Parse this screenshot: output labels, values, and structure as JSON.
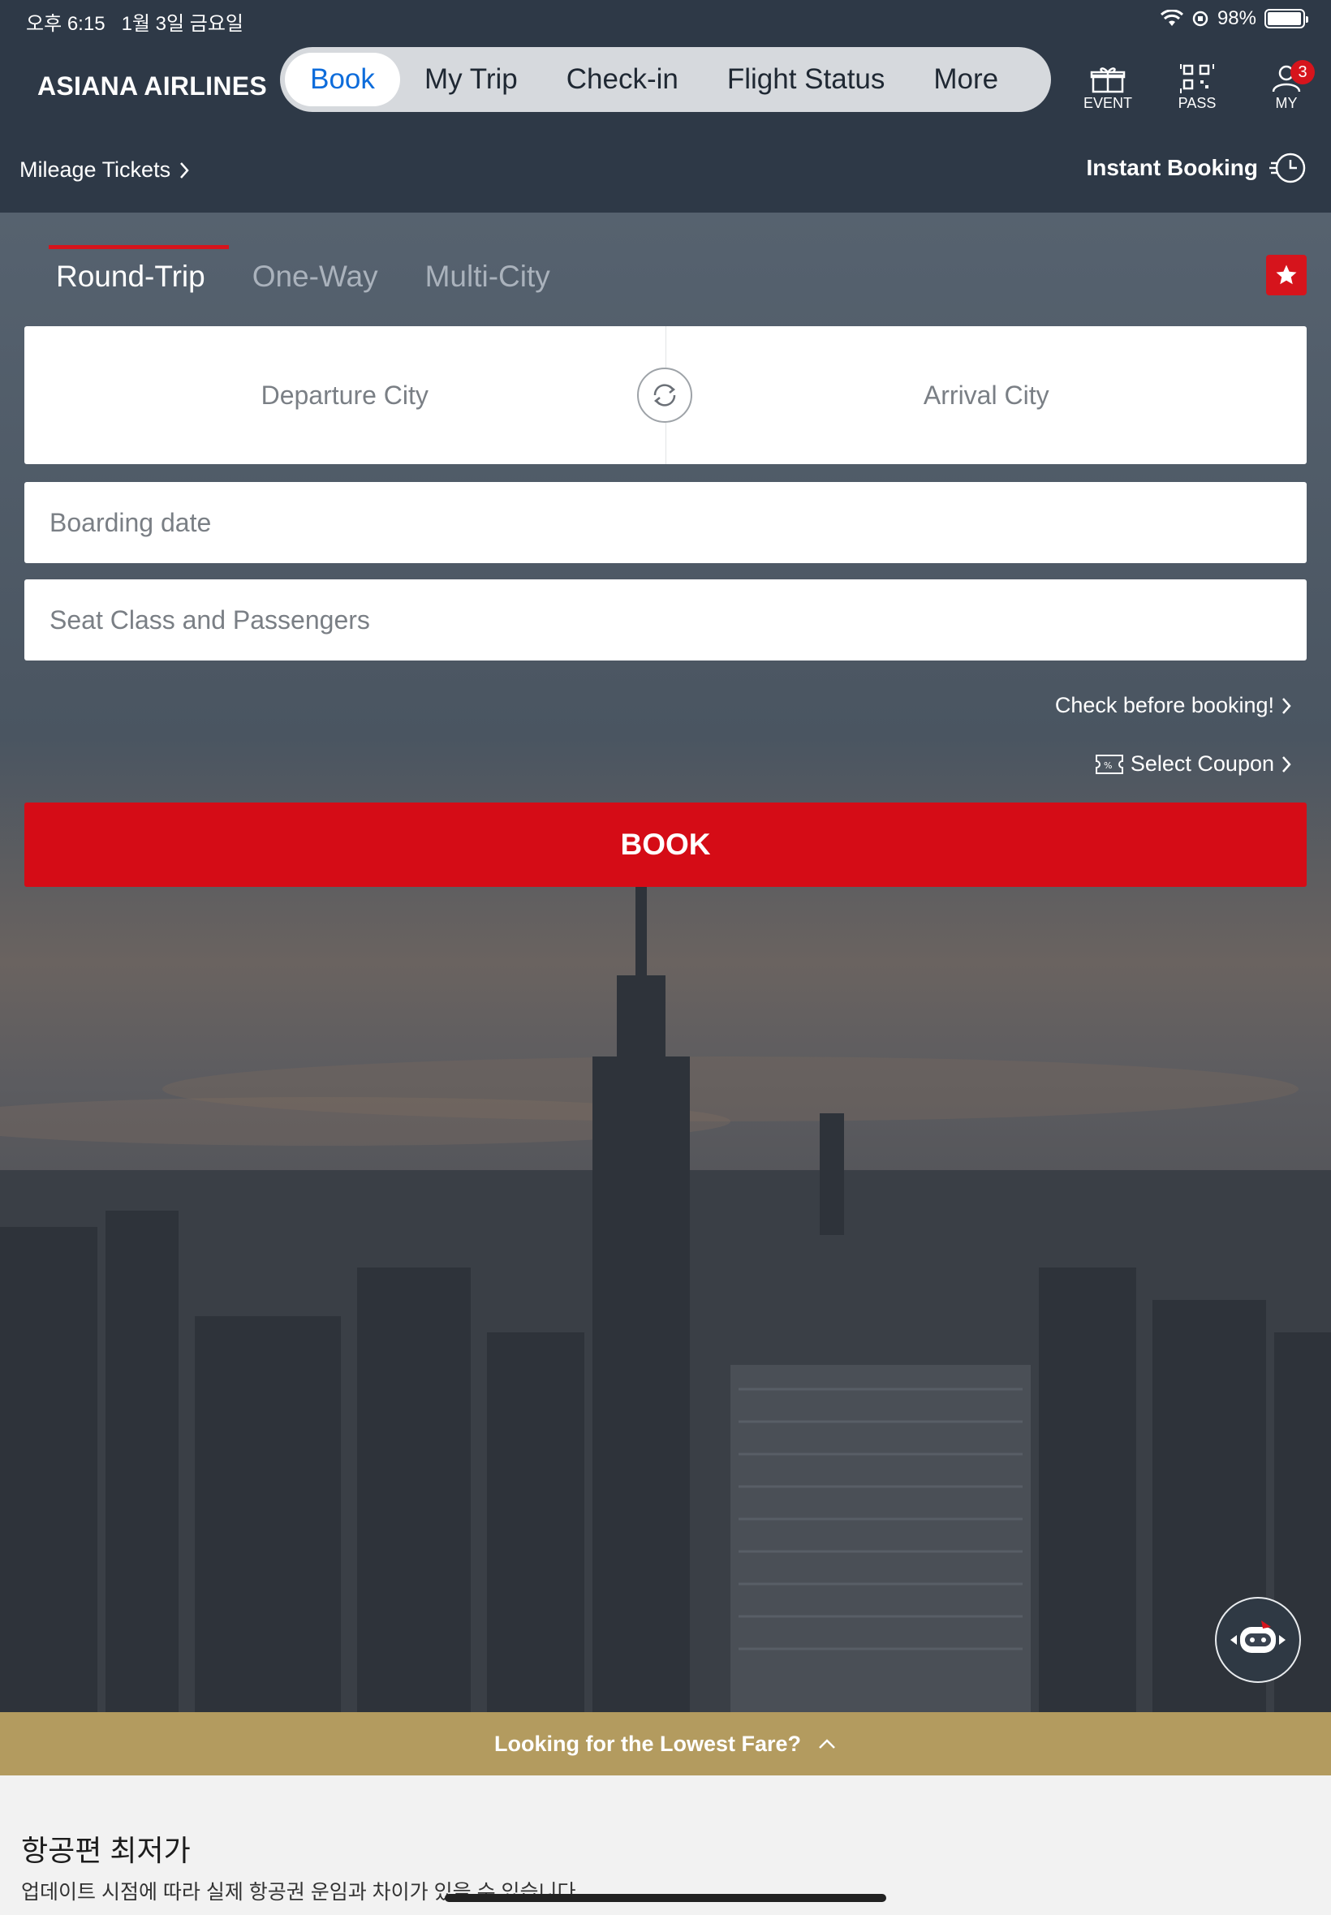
{
  "status": {
    "time": "오후 6:15",
    "date": "1월 3일 금요일",
    "battery": "98%",
    "battery_level": 0.98
  },
  "header": {
    "brand": "ASIANA AIRLINES",
    "nav": [
      "Book",
      "My Trip",
      "Check-in",
      "Flight Status",
      "More"
    ],
    "active_nav": "Book",
    "icons": {
      "event": "EVENT",
      "pass": "PASS",
      "my": "MY",
      "my_badge": "3"
    },
    "mileage": "Mileage Tickets",
    "instant": "Instant Booking"
  },
  "booking": {
    "tabs": [
      "Round-Trip",
      "One-Way",
      "Multi-City"
    ],
    "active_tab": "Round-Trip",
    "departure_placeholder": "Departure City",
    "arrival_placeholder": "Arrival City",
    "boarding_placeholder": "Boarding date",
    "seat_placeholder": "Seat Class and Passengers",
    "check_link": "Check before booking!",
    "coupon_link": "Select Coupon",
    "book_label": "BOOK"
  },
  "fare": {
    "bar_label": "Looking for the Lowest Fare?",
    "title": "항공편 최저가",
    "subtitle": "업데이트 시점에 따라 실제 항공권 운임과 차이가 있을 수 있습니다."
  },
  "colors": {
    "brand_red": "#d50c16",
    "header_bg": "#2e3947",
    "active_blue": "#0d6cdb",
    "fare_gold": "#b39b5f"
  }
}
